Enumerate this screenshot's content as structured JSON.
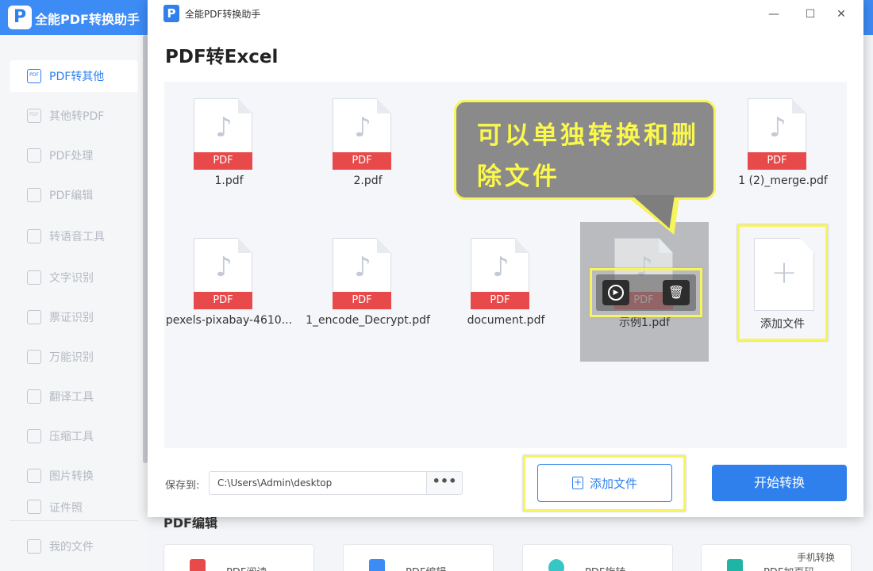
{
  "app": {
    "title": "全能PDF转换助手",
    "logo": "P"
  },
  "sidebar": {
    "items": [
      {
        "label": "PDF转其他",
        "icon": "pdf-icon",
        "active": true
      },
      {
        "label": "其他转PDF",
        "icon": "pdf-icon"
      },
      {
        "label": "PDF处理",
        "icon": "pdf-process-icon"
      },
      {
        "label": "PDF编辑",
        "icon": "pdf-edit-icon"
      },
      {
        "label": "转语音工具",
        "icon": "audio-icon"
      },
      {
        "label": "文字识别",
        "icon": "text-ocr-icon"
      },
      {
        "label": "票证识别",
        "icon": "ticket-icon"
      },
      {
        "label": "万能识别",
        "icon": "scan-icon"
      },
      {
        "label": "翻译工具",
        "icon": "translate-icon"
      },
      {
        "label": "压缩工具",
        "icon": "compress-icon"
      },
      {
        "label": "图片转换",
        "icon": "image-icon"
      },
      {
        "label": "证件照",
        "icon": "id-photo-icon"
      },
      {
        "label": "我的文件",
        "icon": "my-files-icon"
      }
    ]
  },
  "background": {
    "section_title": "PDF编辑",
    "cards": [
      "PDF阅读",
      "PDF编辑",
      "PDF旋转",
      "PDF加页码"
    ],
    "badge": "手机转换"
  },
  "dialog": {
    "title": "全能PDF转换助手",
    "logo": "P",
    "page_title": "PDF转Excel",
    "pdf_tag": "PDF",
    "files": [
      {
        "name": "1.pdf"
      },
      {
        "name": "2.pdf"
      },
      {
        "name": "1 (2)_merge.pdf"
      },
      {
        "name": "pexels-pixabay-4610..."
      },
      {
        "name": "1_encode_Decrypt.pdf"
      },
      {
        "name": "document.pdf"
      },
      {
        "name": "示例1.pdf"
      }
    ],
    "add_tile_label": "添加文件",
    "callout_text": "可以单独转换和删除文件",
    "save_label": "保存到:",
    "save_path": "C:\\Users\\Admin\\desktop",
    "browse_label": "•••",
    "add_button": "添加文件",
    "start_button": "开始转换",
    "window_controls": {
      "minimize": "—",
      "maximize": "☐",
      "close": "✕"
    }
  }
}
